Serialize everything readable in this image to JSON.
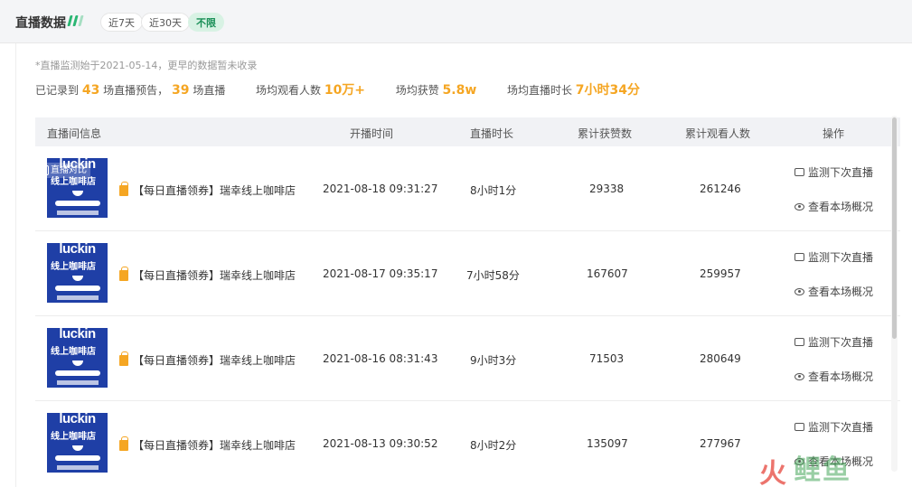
{
  "header": {
    "title": "直播数据",
    "filters": [
      {
        "label": "近7天",
        "active": false
      },
      {
        "label": "近30天",
        "active": false
      },
      {
        "label": "不限",
        "active": true
      }
    ]
  },
  "note": "*直播监测始于2021-05-14，更早的数据暂未收录",
  "summary": {
    "prefix": "已记录到",
    "preview_count": "43",
    "preview_suffix": "场直播预告，",
    "live_count": "39",
    "live_suffix": "场直播",
    "avg_viewers_label": "场均观看人数",
    "avg_viewers": "10万+",
    "avg_likes_label": "场均获赞",
    "avg_likes": "5.8w",
    "avg_duration_label": "场均直播时长",
    "avg_duration": "7小时34分"
  },
  "table": {
    "columns": [
      "直播间信息",
      "开播时间",
      "直播时长",
      "累计获赞数",
      "累计观看人数",
      "操作"
    ],
    "compare_label": "直播对比",
    "thumb_brand": "luckin",
    "thumb_sub": "线上咖啡店",
    "rows": [
      {
        "title": "【每日直播领券】瑞幸线上咖啡店直播",
        "start": "2021-08-18 09:31:27",
        "duration": "8小时1分",
        "likes": "29338",
        "viewers": "261246"
      },
      {
        "title": "【每日直播领券】瑞幸线上咖啡店直播",
        "start": "2021-08-17 09:35:17",
        "duration": "7小时58分",
        "likes": "167607",
        "viewers": "259957"
      },
      {
        "title": "【每日直播领券】瑞幸线上咖啡店直播",
        "start": "2021-08-16 08:31:43",
        "duration": "9小时3分",
        "likes": "71503",
        "viewers": "280649"
      },
      {
        "title": "【每日直播领券】瑞幸线上咖啡店直播",
        "start": "2021-08-13 09:30:52",
        "duration": "8小时2分",
        "likes": "135097",
        "viewers": "277967"
      }
    ],
    "actions": {
      "monitor": "监测下次直播",
      "overview": "查看本场概况"
    }
  },
  "watermark": {
    "fire": "火",
    "text": "鲤鱼"
  },
  "colors": {
    "accent": "#f5a623",
    "green": "#2bb673",
    "active_pill_bg": "#d8f2e4"
  }
}
